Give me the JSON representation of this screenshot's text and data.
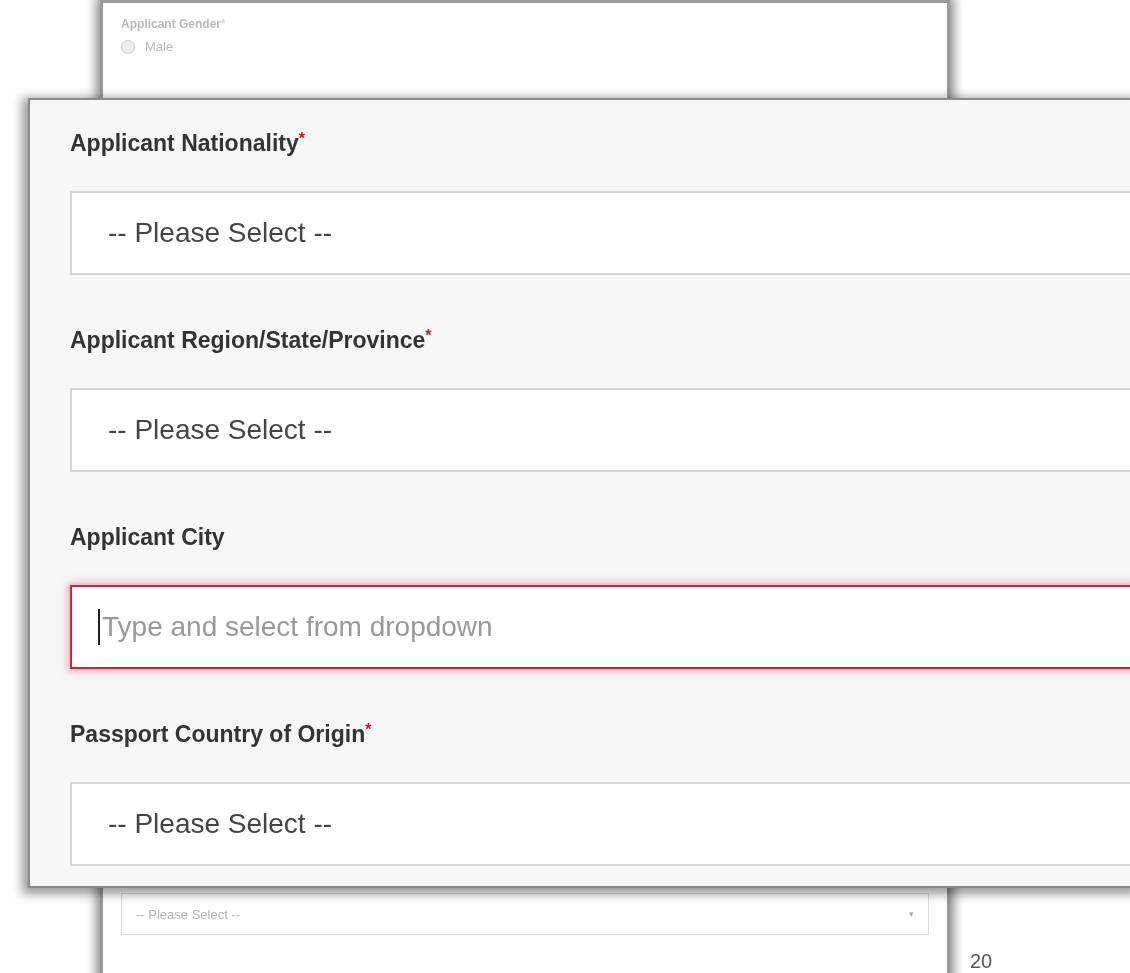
{
  "background_form": {
    "gender": {
      "label": "Applicant Gender",
      "required_mark": "*",
      "options": [
        {
          "label": "Male",
          "selected": false
        }
      ]
    },
    "bottom_select": {
      "value": "-- Please Select --",
      "arrow": "▾"
    }
  },
  "zoomed_form": {
    "fields": [
      {
        "kind": "select",
        "label": "Applicant Nationality",
        "required_mark": "*",
        "value": "-- Please Select --"
      },
      {
        "kind": "select",
        "label": "Applicant Region/State/Province",
        "required_mark": "*",
        "value": "-- Please Select --"
      },
      {
        "kind": "text",
        "label": "Applicant City",
        "placeholder": "Type and select from dropdown",
        "focused": true
      },
      {
        "kind": "select",
        "label": "Passport Country of Origin",
        "required_mark": "*",
        "value": "-- Please Select --"
      }
    ]
  },
  "page_number": "20"
}
